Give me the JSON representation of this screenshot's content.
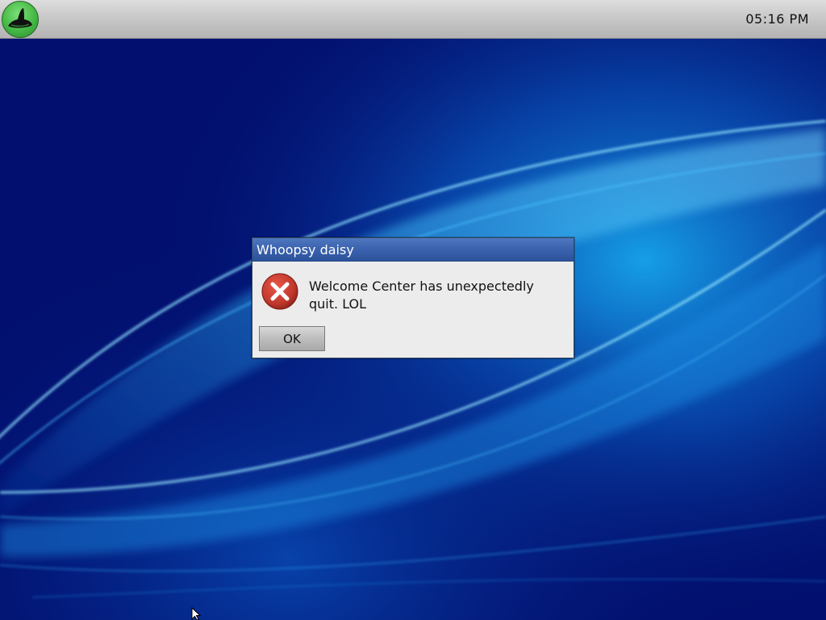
{
  "panel": {
    "start_icon": "green-hat-logo-icon",
    "clock": "05:16 PM"
  },
  "dialog": {
    "title": "Whoopsy daisy",
    "icon": "error-x-icon",
    "message": "Welcome Center has unexpectedly quit. LOL",
    "ok_label": "OK"
  },
  "colors": {
    "titlebar": "#3a62ad",
    "panel": "#c9c9c9",
    "desktop": "#020f6e",
    "error_icon": "#c0392b",
    "start_button": "#45b945"
  },
  "cursor": {
    "icon": "mouse-pointer-icon"
  }
}
